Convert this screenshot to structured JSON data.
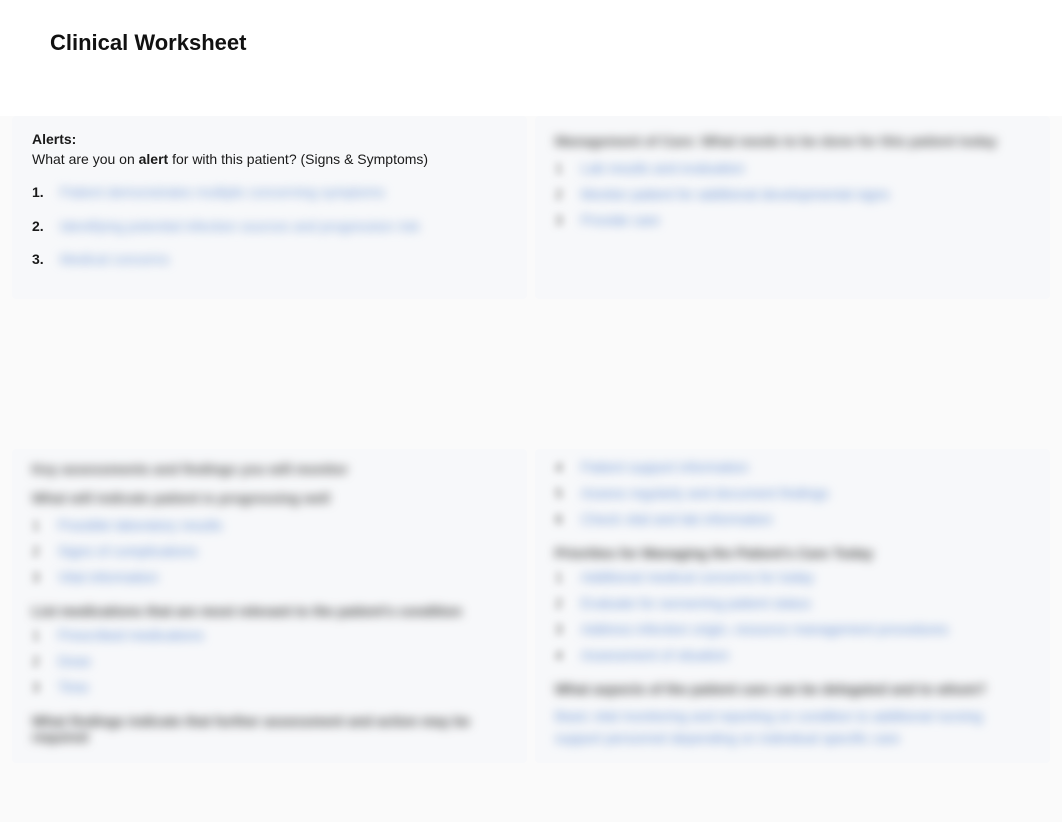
{
  "header": {
    "title": "Clinical Worksheet"
  },
  "alerts": {
    "label": "Alerts:",
    "prompt_prefix": "What are you on",
    "prompt_bold": "alert",
    "prompt_suffix": " for with this patient? (Signs & Symptoms)",
    "items": [
      {
        "num": "1.",
        "text": "Patient demonstrates multiple concerning symptoms"
      },
      {
        "num": "2.",
        "text": "Identifying potential infection sources and progression risk"
      },
      {
        "num": "3.",
        "text": "Medical concerns"
      }
    ]
  },
  "management": {
    "heading": "Management of Care: What needs to be done for this patient today",
    "items": [
      {
        "num": "1",
        "text": "Lab results and evaluation"
      },
      {
        "num": "2",
        "text": "Monitor patient for additional developmental signs"
      },
      {
        "num": "3",
        "text": "Provide care"
      }
    ]
  },
  "lower_left": {
    "heading1": "Key assessments and findings you will monitor",
    "subheading1": "What will indicate patient is progressing well",
    "items1": [
      {
        "num": "1",
        "text": "Possible laboratory results"
      },
      {
        "num": "2",
        "text": "Signs of complications"
      },
      {
        "num": "3",
        "text": "Vital information"
      }
    ],
    "heading2": "List medications that are most relevant to the patient's condition",
    "items2": [
      {
        "num": "1",
        "text": "Prescribed medications"
      },
      {
        "num": "2",
        "text": "Dose"
      },
      {
        "num": "3",
        "text": "Time"
      }
    ],
    "heading3": "What findings indicate that further assessment and action may be required"
  },
  "lower_right": {
    "items_top": [
      {
        "num": "4",
        "text": "Patient support information"
      },
      {
        "num": "5",
        "text": "Assess regularly and document findings"
      },
      {
        "num": "6",
        "text": "Check vital and lab information"
      }
    ],
    "heading1": "Priorities for Managing the Patient's Care Today",
    "items1": [
      {
        "num": "1",
        "text": "Additional medical concerns for today"
      },
      {
        "num": "2",
        "text": "Evaluate for worsening patient status"
      },
      {
        "num": "3",
        "text": "Address infection origin, resource management procedures"
      },
      {
        "num": "4",
        "text": "Assessment of situation"
      }
    ],
    "heading2": "What aspects of the patient care can be delegated and to whom?",
    "text2": "Basic vital monitoring and reporting on condition to additional nursing support personnel depending on individual specific care"
  }
}
